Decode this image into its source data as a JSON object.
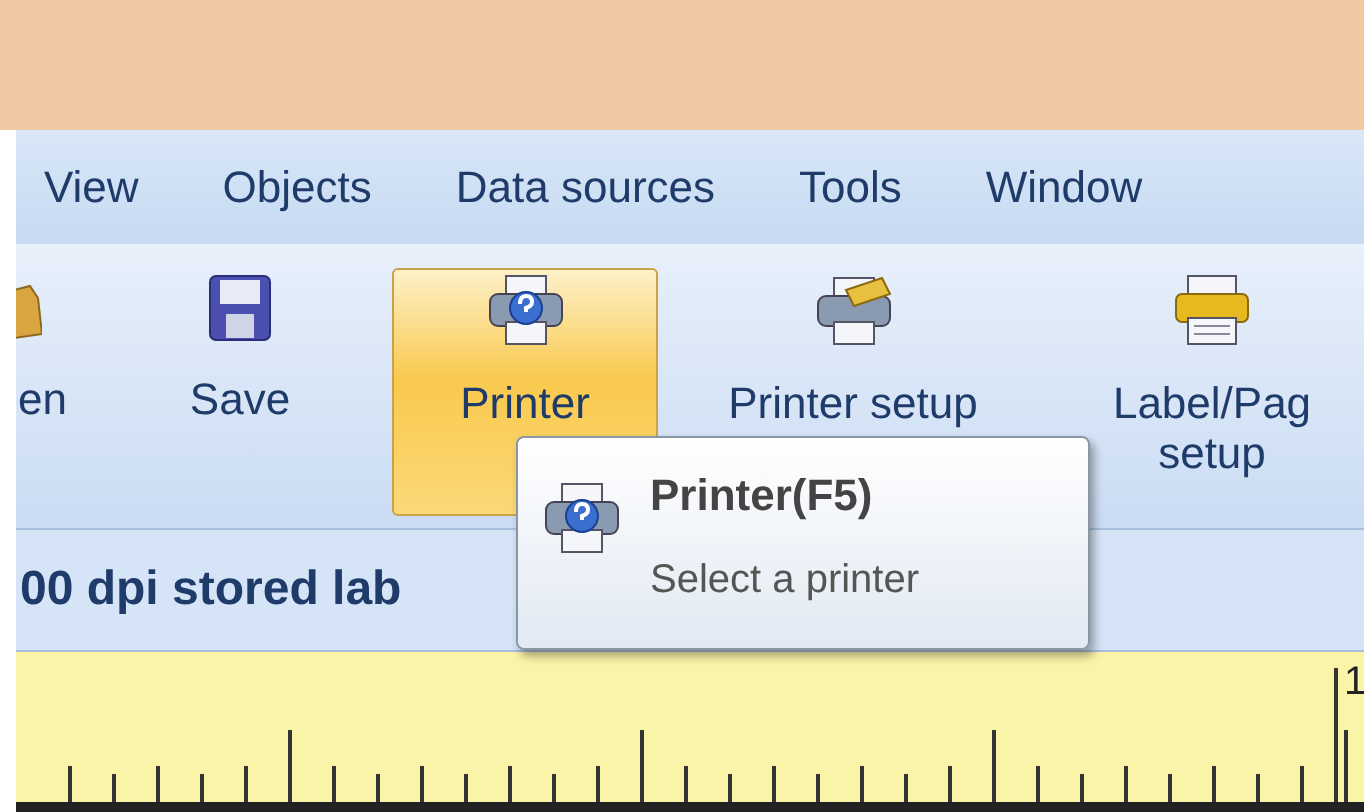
{
  "menu": [
    "View",
    "Objects",
    "Data sources",
    "Tools",
    "Window"
  ],
  "toolbar": {
    "groups": [
      [
        {
          "label": "en",
          "selected": false
        },
        {
          "label": "Save",
          "selected": false
        }
      ],
      [
        {
          "label": "Printer",
          "selected": true
        },
        {
          "label": "Printer setup",
          "selected": false
        },
        {
          "label": "Label/Pag\nsetup",
          "selected": false
        }
      ]
    ]
  },
  "info_bar": {
    "text": "00 dpi stored lab"
  },
  "tooltip": {
    "title": "Printer(F5)",
    "description": "Select a printer"
  },
  "ruler": {
    "label": "1"
  }
}
